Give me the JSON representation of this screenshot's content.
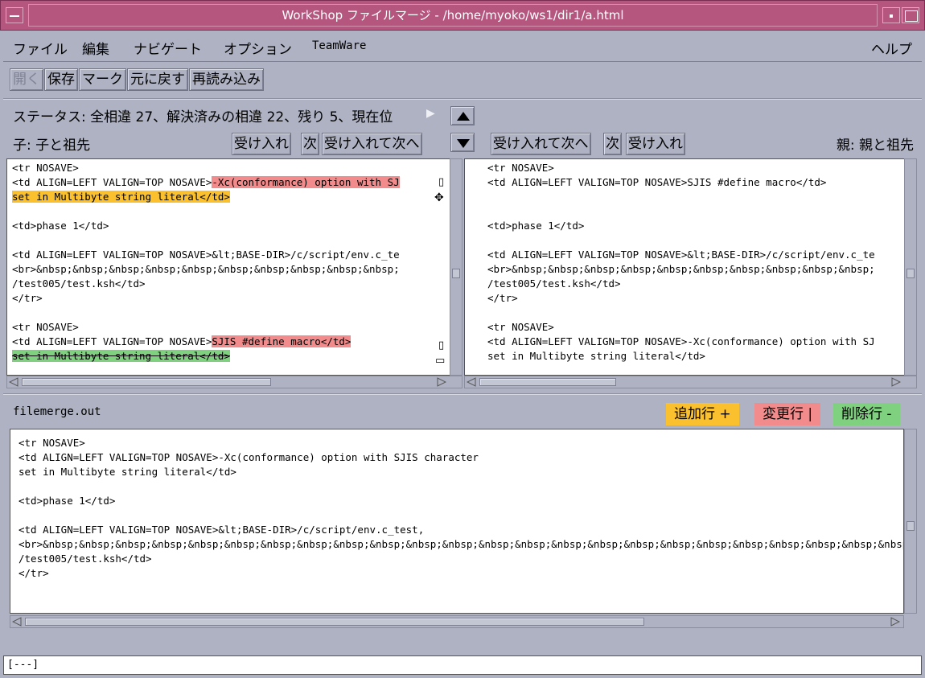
{
  "window": {
    "title": "WorkShop ファイルマージ - /home/myoko/ws1/dir1/a.html"
  },
  "menu": {
    "file": "ファイル",
    "edit": "編集",
    "navigate": "ナビゲート",
    "options": "オプション",
    "teamware": "TeamWare",
    "help": "ヘルプ"
  },
  "toolbar": {
    "open": "開く",
    "save": "保存",
    "mark": "マーク",
    "undo": "元に戻す",
    "reload": "再読み込み"
  },
  "status": {
    "text": "ステータス: 全相違 27、解決済みの相違 22、残り 5、現在位"
  },
  "left": {
    "label": "子: 子と祖先",
    "accept": "受け入れ",
    "next": "次",
    "accept_next": "受け入れて次へ",
    "lines": [
      {
        "pre": "<tr NOSAVE>"
      },
      {
        "pre": "<td ALIGN=LEFT VALIGN=TOP NOSAVE>",
        "hl": "-Xc(conformance) option with SJ",
        "hlclass": "hl-red"
      },
      {
        "hl": "set in Multibyte string literal</td>",
        "hlclass": "hl-orange"
      },
      {
        "pre": ""
      },
      {
        "pre": "<td>phase 1</td>"
      },
      {
        "pre": ""
      },
      {
        "pre": "<td ALIGN=LEFT VALIGN=TOP NOSAVE>&lt;BASE-DIR>/c/script/env.c_te"
      },
      {
        "pre": "<br>&nbsp;&nbsp;&nbsp;&nbsp;&nbsp;&nbsp;&nbsp;&nbsp;&nbsp;&nbsp;"
      },
      {
        "pre": "/test005/test.ksh</td>"
      },
      {
        "pre": "</tr>"
      },
      {
        "pre": ""
      },
      {
        "pre": "<tr NOSAVE>"
      },
      {
        "pre": "<td ALIGN=LEFT VALIGN=TOP NOSAVE>",
        "hl": "SJIS #define macro</td>",
        "hlclass": "hl-red"
      },
      {
        "hl": "set in Multibyte string literal</td>",
        "hlclass": "hl-green"
      }
    ]
  },
  "right": {
    "label": "親: 親と祖先",
    "accept_next": "受け入れて次へ",
    "next": "次",
    "accept": "受け入れ",
    "lines": [
      "<tr NOSAVE>",
      "<td ALIGN=LEFT VALIGN=TOP NOSAVE>SJIS #define macro</td>",
      "",
      "",
      "<td>phase 1</td>",
      "",
      "<td ALIGN=LEFT VALIGN=TOP NOSAVE>&lt;BASE-DIR>/c/script/env.c_te",
      "<br>&nbsp;&nbsp;&nbsp;&nbsp;&nbsp;&nbsp;&nbsp;&nbsp;&nbsp;&nbsp;",
      "/test005/test.ksh</td>",
      "</tr>",
      "",
      "<tr NOSAVE>",
      "<td ALIGN=LEFT VALIGN=TOP NOSAVE>-Xc(conformance) option with SJ",
      "set in Multibyte string literal</td>"
    ]
  },
  "output": {
    "filename": "filemerge.out",
    "legend_added": "追加行 +",
    "legend_changed": "変更行 |",
    "legend_deleted": "削除行 -",
    "lines": [
      "<tr NOSAVE>",
      "<td ALIGN=LEFT VALIGN=TOP NOSAVE>-Xc(conformance) option with SJIS character",
      "set in Multibyte string literal</td>",
      "",
      "<td>phase 1</td>",
      "",
      "<td ALIGN=LEFT VALIGN=TOP NOSAVE>&lt;BASE-DIR>/c/script/env.c_test,",
      "<br>&nbsp;&nbsp;&nbsp;&nbsp;&nbsp;&nbsp;&nbsp;&nbsp;&nbsp;&nbsp;&nbsp;&nbsp;&nbsp;&nbsp;&nbsp;&nbsp;&nbsp;&nbsp;&nbsp;&nbsp;&nbsp;&nbsp;&nbsp;&nbsp;&nbsp;&",
      "/test005/test.ksh</td>",
      "</tr>"
    ]
  },
  "footer": {
    "text": "[---]"
  },
  "colors": {
    "added": "#fbc02d",
    "changed": "#f28b8b",
    "deleted": "#7fd17f",
    "titlebar": "#b5567f"
  }
}
